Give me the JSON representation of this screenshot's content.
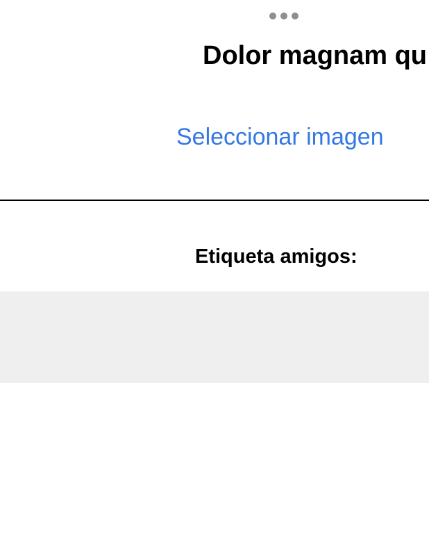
{
  "header": {
    "more_icon": "more-horizontal-icon",
    "title": "Dolor magnam qu"
  },
  "image_picker": {
    "select_label": "Seleccionar imagen"
  },
  "tag_section": {
    "label": "Etiqueta amigos:",
    "field_value": ""
  },
  "colors": {
    "accent": "#3478e4",
    "dots": "#8e8e93",
    "field_background": "#efefef",
    "divider": "#000000"
  }
}
